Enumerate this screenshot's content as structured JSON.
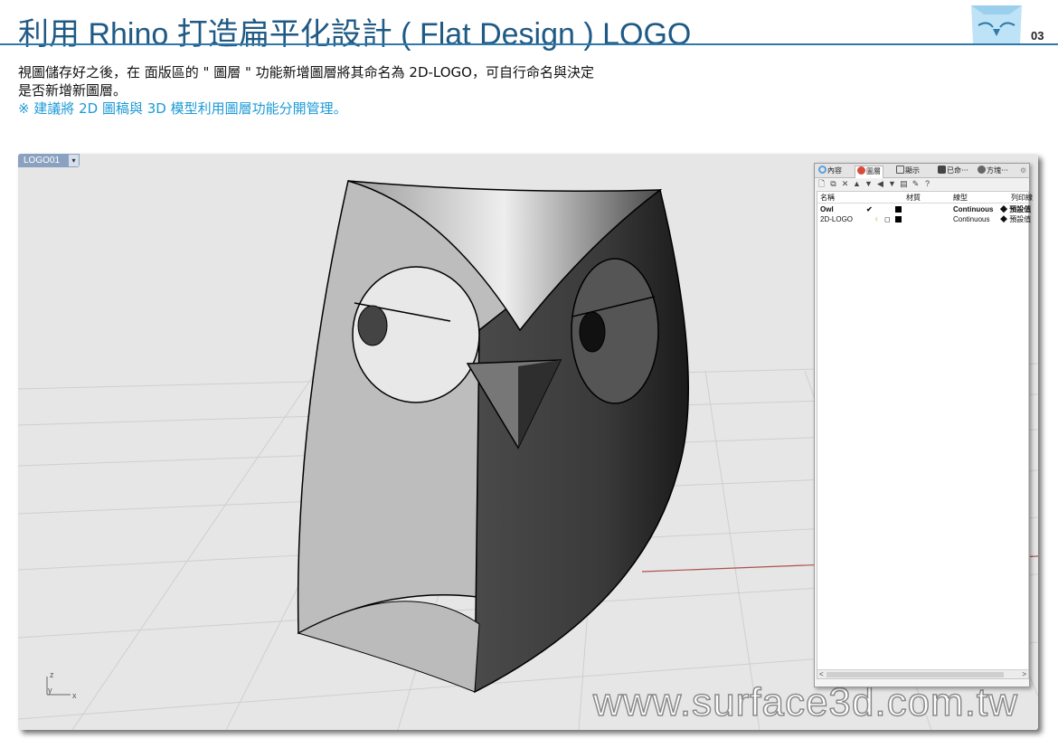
{
  "header": {
    "title": "利用 Rhino 打造扁平化設計 ( Flat Design ) LOGO",
    "page_number": "03"
  },
  "instructions": {
    "line1": "視圖儲存好之後，在 面版區的 \" 圖層 \" 功能新增圖層將其命名為 2D-LOGO，可自行命名與決定",
    "line2": "是否新增新圖層。",
    "note": "※ 建議將 2D 圖稿與 3D 模型利用圖層功能分開管理。"
  },
  "viewport": {
    "tab_label": "LOGO01",
    "caret": "▾",
    "axis_z": "z",
    "axis_y": "y",
    "axis_x": "x",
    "watermark": "www.surface3d.com.tw"
  },
  "panel": {
    "tabs": [
      {
        "label": "內容",
        "icon": "properties-icon"
      },
      {
        "label": "圖層",
        "icon": "layers-icon"
      },
      {
        "label": "顯示",
        "icon": "display-icon"
      },
      {
        "label": "已命⋯",
        "icon": "named-views-icon"
      },
      {
        "label": "方塊⋯",
        "icon": "blocks-icon"
      }
    ],
    "columns": [
      "名稱",
      "材質",
      "線型",
      "列印線"
    ],
    "layers": [
      {
        "name": "Owl",
        "current": "✔",
        "linetype": "Continuous",
        "print": "◆ 預設值"
      },
      {
        "name": "2D-LOGO",
        "current": "",
        "linetype": "Continuous",
        "print": "◆ 預設值"
      }
    ],
    "scroll_left": "<",
    "scroll_right": ">"
  },
  "colors": {
    "title": "#1f5a85",
    "note": "#1c9ad6",
    "rule": "#2f79ab"
  }
}
